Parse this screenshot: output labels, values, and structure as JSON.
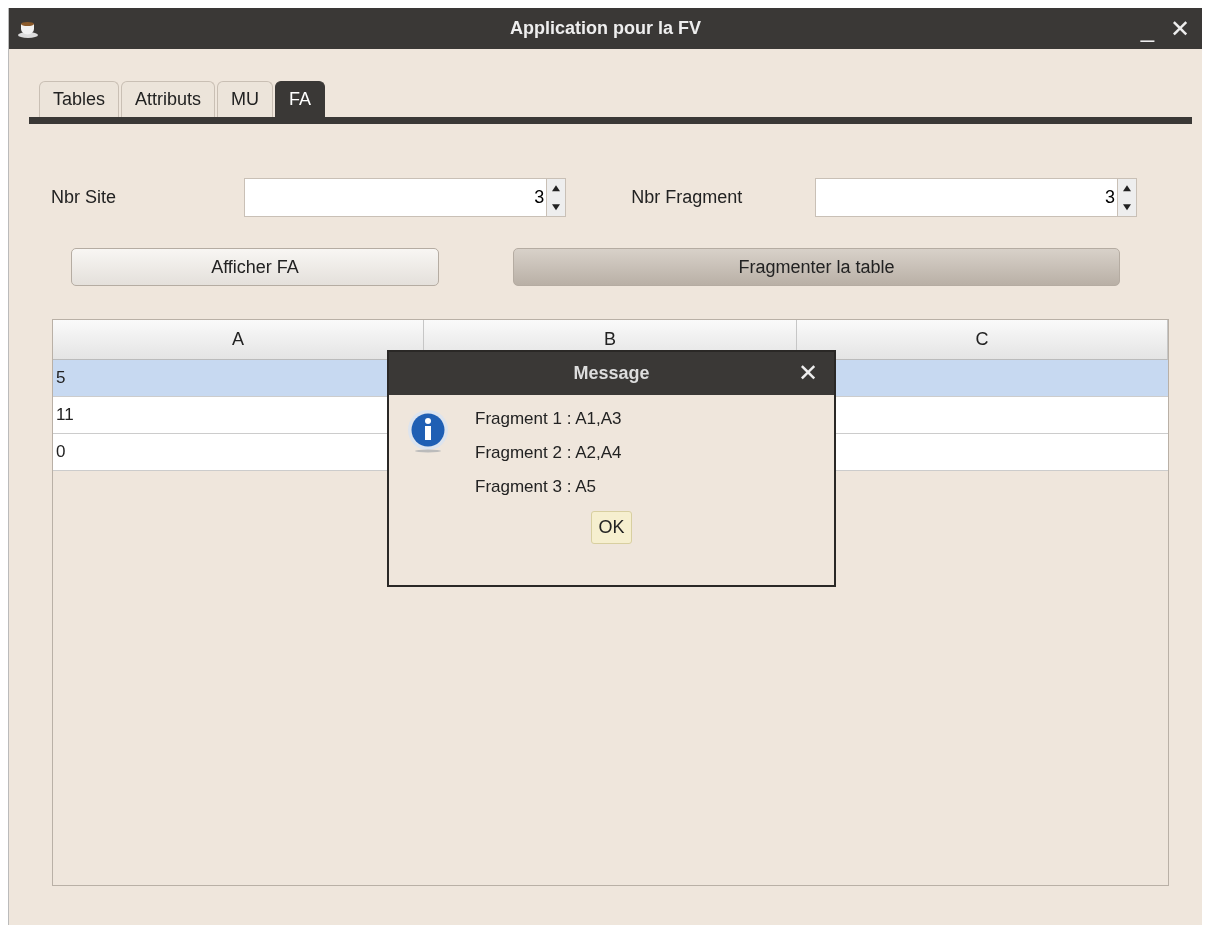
{
  "window": {
    "title": "Application pour la FV",
    "controls": [
      "_",
      "✕"
    ]
  },
  "tabs": [
    {
      "label": "Tables",
      "selected": false
    },
    {
      "label": "Attributs",
      "selected": false
    },
    {
      "label": "MU",
      "selected": false
    },
    {
      "label": "FA",
      "selected": true
    }
  ],
  "form": [
    {
      "label": "Nbr Site",
      "value": "3"
    },
    {
      "label": "Nbr Fragment",
      "value": "3"
    }
  ],
  "buttons": [
    {
      "label": "Afficher FA",
      "selected": false
    },
    {
      "label": "Fragmenter la table",
      "selected": true
    }
  ],
  "table": {
    "columns": [
      "A",
      "B",
      "C"
    ],
    "rows": [
      {
        "a": "5",
        "selected": true
      },
      {
        "a": "11",
        "selected": false
      },
      {
        "a": "0",
        "selected": false
      }
    ]
  },
  "dialog": {
    "title": "Message",
    "close": "✕",
    "lines": [
      "Fragment 1 : A1,A3",
      "Fragment 2 : A2,A4",
      "Fragment 3 : A5"
    ],
    "button": "OK"
  }
}
